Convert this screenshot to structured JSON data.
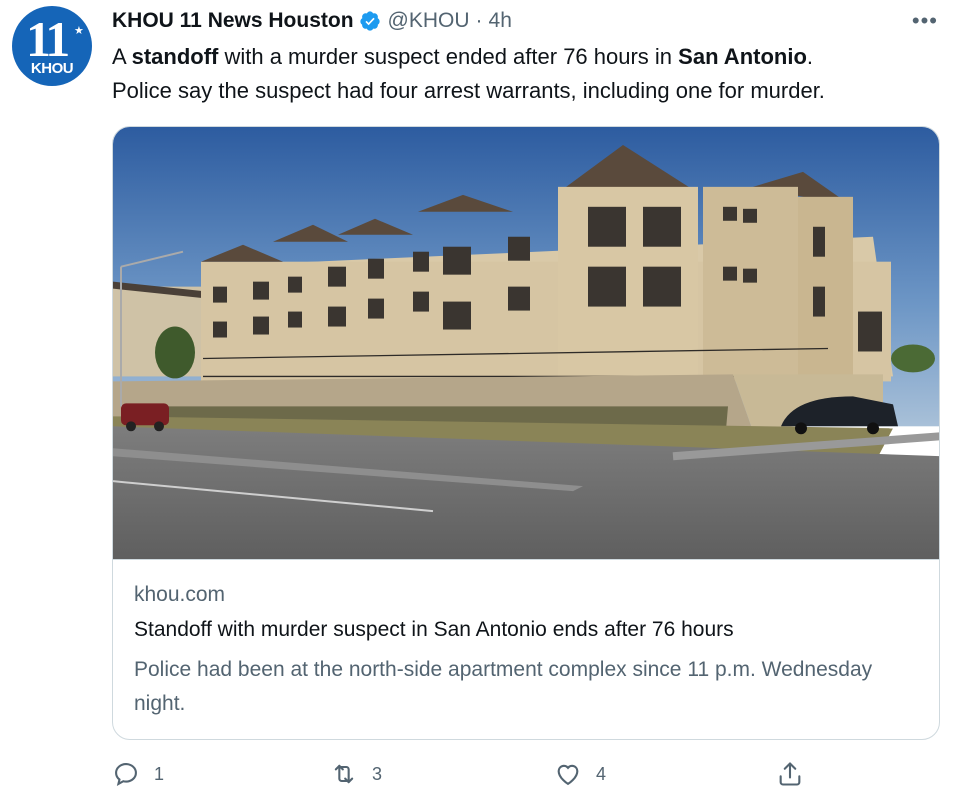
{
  "author": {
    "avatar": {
      "number": "11",
      "callsign": "KHOU"
    },
    "name": "KHOU 11 News Houston",
    "handle": "@KHOU",
    "separator": "·",
    "time": "4h"
  },
  "tweet": {
    "parts": [
      {
        "text": "A ",
        "bold": false
      },
      {
        "text": "standoff",
        "bold": true
      },
      {
        "text": " with a murder suspect ended after 76 hours in ",
        "bold": false
      },
      {
        "text": "San Antonio",
        "bold": true
      },
      {
        "text": ".",
        "bold": false
      },
      {
        "text": "Police say the suspect had four arrest warrants, including one for murder.",
        "bold": false
      }
    ]
  },
  "card": {
    "domain": "khou.com",
    "title": "Standoff with murder suspect in San Antonio ends after 76 hours",
    "description": "Police had been at the north-side apartment complex since 11 p.m. Wednesday night."
  },
  "actions": {
    "reply_count": "1",
    "retweet_count": "3",
    "like_count": "4"
  },
  "icons": [
    "verified-badge-icon",
    "more-options-icon",
    "reply-icon",
    "retweet-icon",
    "like-icon",
    "share-icon"
  ],
  "colors": {
    "verified": "#1d9bf0",
    "secondary_text": "#536471",
    "brand": "#1565b8"
  }
}
